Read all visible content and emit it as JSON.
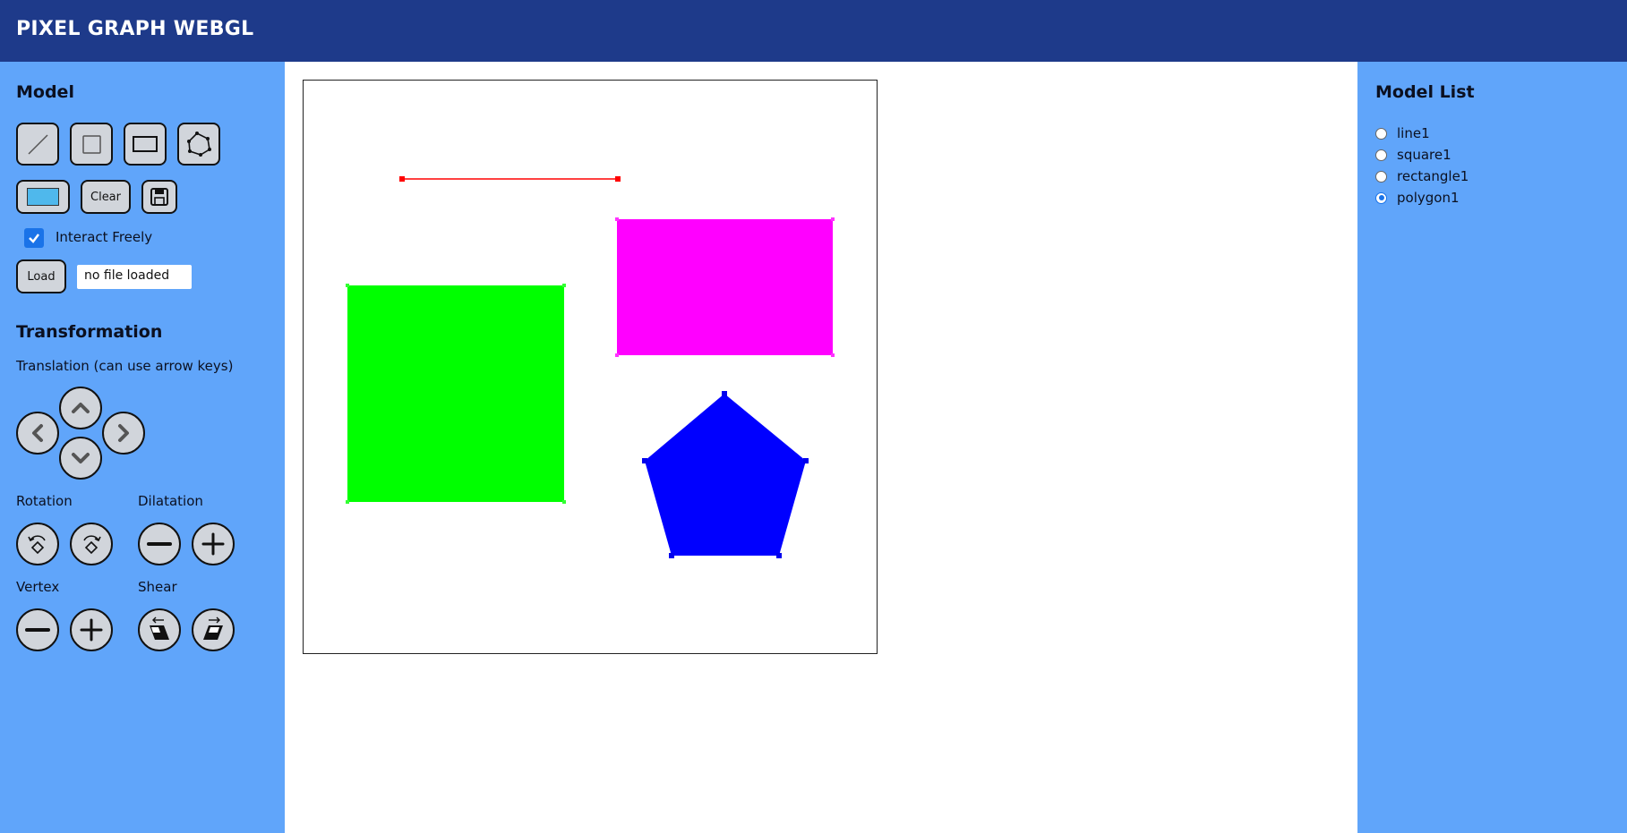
{
  "header": {
    "title": "PIXEL GRAPH WEBGL"
  },
  "model_section": {
    "heading": "Model",
    "tools": [
      {
        "name": "line-tool",
        "icon": "line-icon"
      },
      {
        "name": "square-tool",
        "icon": "square-icon"
      },
      {
        "name": "rectangle-tool",
        "icon": "rectangle-icon"
      },
      {
        "name": "polygon-tool",
        "icon": "polygon-icon"
      }
    ],
    "color_value": "#4fb8ec",
    "clear_label": "Clear",
    "save_icon": "save-icon",
    "interact_freely_label": "Interact Freely",
    "interact_freely_checked": true,
    "load_label": "Load",
    "file_status": "no file loaded"
  },
  "transformation_section": {
    "heading": "Transformation",
    "translation_label": "Translation (can use arrow keys)",
    "rotation_label": "Rotation",
    "dilatation_label": "Dilatation",
    "vertex_label": "Vertex",
    "shear_label": "Shear"
  },
  "model_list": {
    "heading": "Model List",
    "items": [
      {
        "label": "line1",
        "selected": false
      },
      {
        "label": "square1",
        "selected": false
      },
      {
        "label": "rectangle1",
        "selected": false
      },
      {
        "label": "polygon1",
        "selected": true
      }
    ]
  },
  "canvas": {
    "shapes": [
      {
        "name": "line1",
        "type": "line",
        "color": "#ff0000"
      },
      {
        "name": "square1",
        "type": "square",
        "color": "#00ff00"
      },
      {
        "name": "rectangle1",
        "type": "rectangle",
        "color": "#ff00ff"
      },
      {
        "name": "polygon1",
        "type": "polygon",
        "color": "#0000ff"
      }
    ]
  },
  "colors": {
    "header_bg": "#1e3a8a",
    "panel_bg": "#60a5fa",
    "button_bg": "#d1d5db",
    "checkbox_accent": "#1a73e8"
  }
}
